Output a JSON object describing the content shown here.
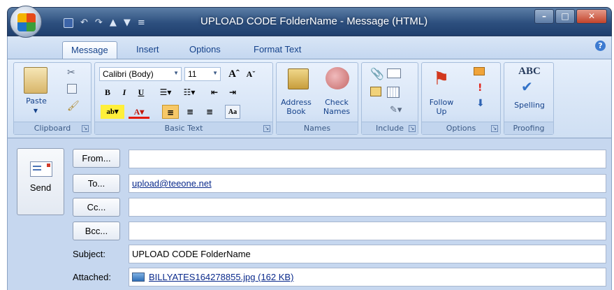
{
  "window": {
    "title": "UPLOAD CODE FolderName - Message (HTML)"
  },
  "ribbon": {
    "tabs": [
      "Message",
      "Insert",
      "Options",
      "Format Text"
    ],
    "clipboard": {
      "label": "Clipboard",
      "paste": "Paste"
    },
    "basic_text": {
      "label": "Basic Text",
      "font": "Calibri (Body)",
      "size": "11"
    },
    "names": {
      "label": "Names",
      "address_book_1": "Address",
      "address_book_2": "Book",
      "check_names_1": "Check",
      "check_names_2": "Names"
    },
    "include": {
      "label": "Include"
    },
    "options": {
      "label": "Options",
      "follow_up_1": "Follow",
      "follow_up_2": "Up"
    },
    "proofing": {
      "label": "Proofing",
      "spelling": "Spelling",
      "abc": "ABC"
    }
  },
  "message": {
    "send": "Send",
    "from_button": "From...",
    "to_button": "To...",
    "cc_button": "Cc...",
    "bcc_button": "Bcc...",
    "from_value": "",
    "to_value": "upload@teeone.net",
    "cc_value": "",
    "bcc_value": "",
    "subject_label": "Subject:",
    "subject_value": "UPLOAD CODE FolderName",
    "attached_label": "Attached:",
    "attachment": "BILLYATES164278855.jpg (162 KB)"
  }
}
